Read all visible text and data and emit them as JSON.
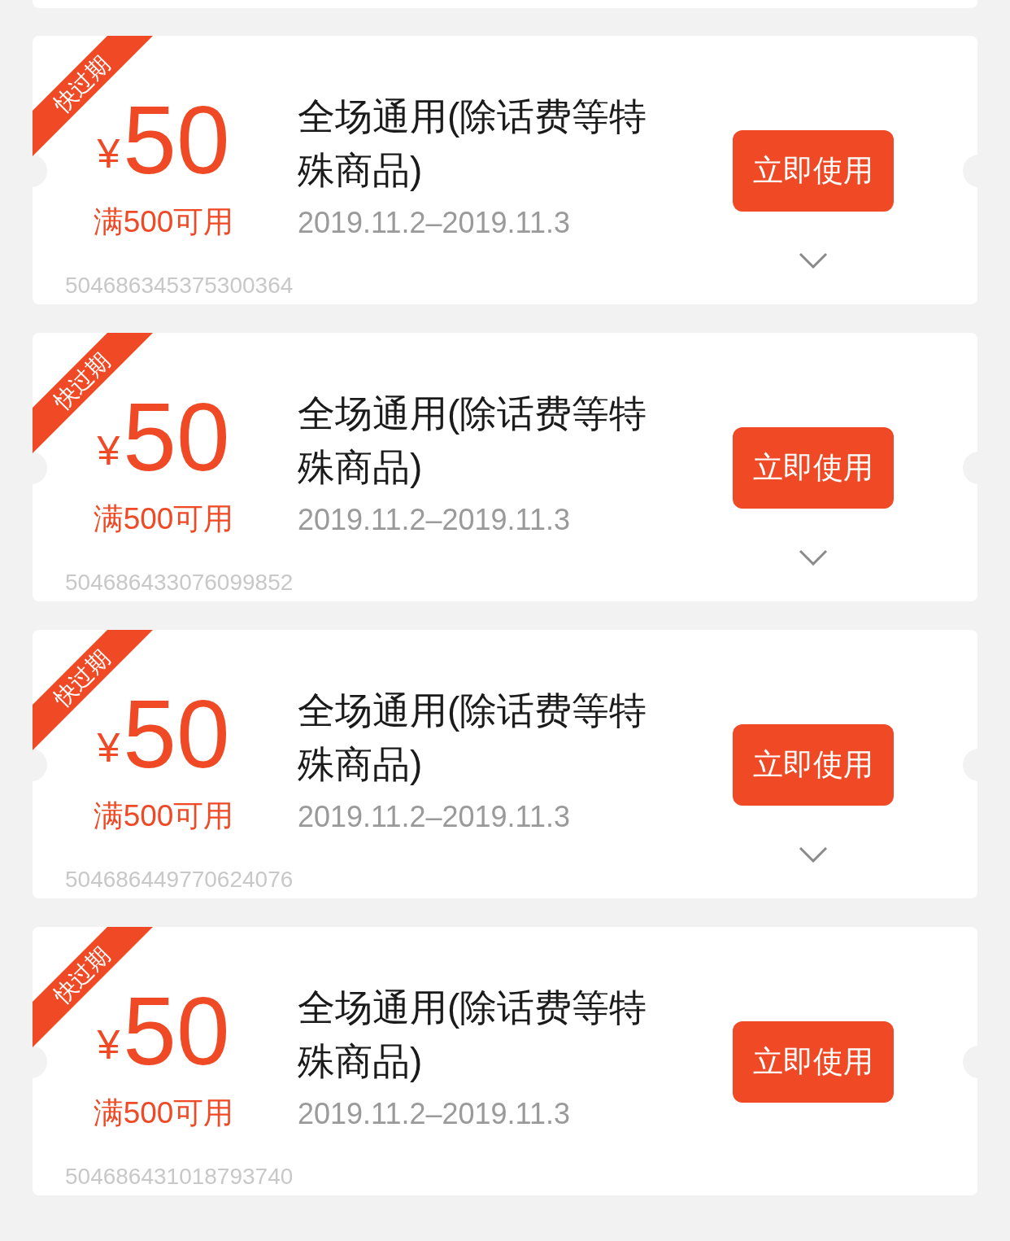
{
  "coupons": [
    {
      "badge": "快过期",
      "currency": "¥",
      "amount": "50",
      "condition": "满500可用",
      "title": "全场通用(除话费等特殊商品)",
      "validity": "2019.11.2–2019.11.3",
      "button": "立即使用",
      "expandable": true,
      "code": "504686345375300364"
    },
    {
      "badge": "快过期",
      "currency": "¥",
      "amount": "50",
      "condition": "满500可用",
      "title": "全场通用(除话费等特殊商品)",
      "validity": "2019.11.2–2019.11.3",
      "button": "立即使用",
      "expandable": true,
      "code": "504686433076099852"
    },
    {
      "badge": "快过期",
      "currency": "¥",
      "amount": "50",
      "condition": "满500可用",
      "title": "全场通用(除话费等特殊商品)",
      "validity": "2019.11.2–2019.11.3",
      "button": "立即使用",
      "expandable": true,
      "code": "504686449770624076"
    },
    {
      "badge": "快过期",
      "currency": "¥",
      "amount": "50",
      "condition": "满500可用",
      "title": "全场通用(除话费等特殊商品)",
      "validity": "2019.11.2–2019.11.3",
      "button": "立即使用",
      "expandable": false,
      "code": "504686431018793740"
    }
  ]
}
